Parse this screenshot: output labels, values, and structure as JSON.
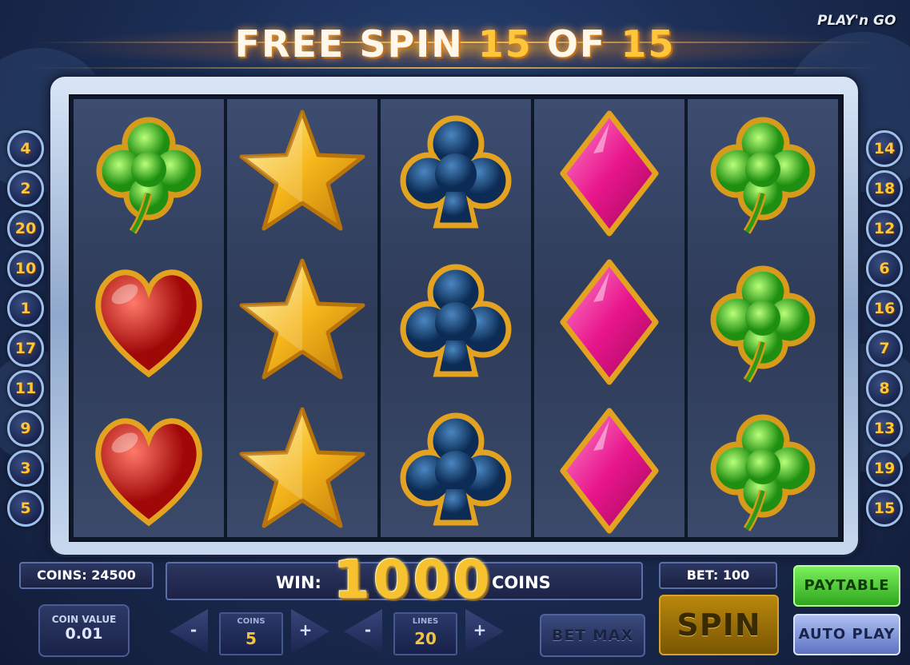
{
  "banner": {
    "prefix": "FREE SPIN",
    "current": "15",
    "of": "OF",
    "total": "15"
  },
  "brand": "PLAY'n GO",
  "reels": [
    [
      "clover",
      "heart",
      "heart"
    ],
    [
      "star",
      "star",
      "star"
    ],
    [
      "club",
      "club",
      "club"
    ],
    [
      "diamond",
      "diamond",
      "diamond"
    ],
    [
      "clover",
      "clover",
      "clover"
    ]
  ],
  "paylines": {
    "left": [
      "4",
      "2",
      "20",
      "10",
      "1",
      "17",
      "11",
      "9",
      "3",
      "5"
    ],
    "right": [
      "14",
      "18",
      "12",
      "6",
      "16",
      "7",
      "8",
      "13",
      "19",
      "15"
    ]
  },
  "status": {
    "coins": "COINS: 24500",
    "bet": "BET: 100",
    "win_label": "WIN:",
    "win_value": "1000",
    "win_unit": "COINS"
  },
  "coin_value": {
    "label": "COIN VALUE",
    "value": "0.01"
  },
  "coins_stepper": {
    "label": "COINS",
    "value": "5",
    "minus": "-",
    "plus": "+"
  },
  "lines_stepper": {
    "label": "LINES",
    "value": "20",
    "minus": "-",
    "plus": "+"
  },
  "buttons": {
    "bet_max": "BET MAX",
    "spin": "SPIN",
    "paytable": "PAYTABLE",
    "auto_play": "AUTO PLAY"
  },
  "colors": {
    "gold": "#f7c230",
    "background": "#1c2f57",
    "paytable": "#2fa61e",
    "autoplay": "#5c73c4"
  }
}
